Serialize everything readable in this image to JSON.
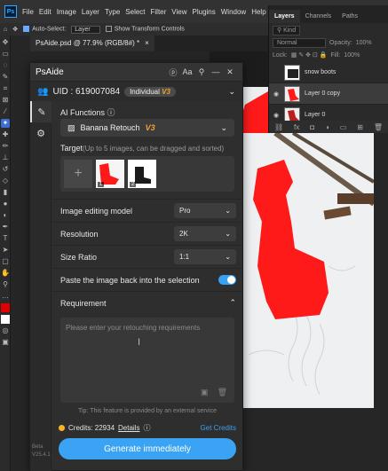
{
  "app": {
    "menu": [
      "File",
      "Edit",
      "Image",
      "Layer",
      "Type",
      "Select",
      "Filter",
      "View",
      "Plugins",
      "Window",
      "Help"
    ],
    "logo": "Ps",
    "options": {
      "auto_select_label": "Auto-Select:",
      "auto_select_value": "Layer",
      "show_transform_label": "Show Transform Controls"
    },
    "document_tab": "PsAide.psd @ 77.9% (RGB/8#) *",
    "document_close": "×"
  },
  "layers_panel": {
    "tabs": [
      "Layers",
      "Channels",
      "Paths"
    ],
    "kind_label": "Kind",
    "blend_mode": "Normal",
    "opacity_label": "Opacity:",
    "opacity_value": "100%",
    "lock_label": "Lock:",
    "fill_label": "Fill:",
    "fill_value": "100%",
    "layers": [
      {
        "name": "snow boots",
        "visible": false
      },
      {
        "name": "Layer 0 copy",
        "visible": true
      },
      {
        "name": "Layer 0",
        "visible": true
      }
    ],
    "footer_icons": [
      "link-icon",
      "fx-icon",
      "mask-icon",
      "adjustment-icon",
      "folder-icon",
      "new-layer-icon",
      "trash-icon"
    ]
  },
  "plugin": {
    "title": "PsAide",
    "title_icons": [
      "logo-icon",
      "font-size-icon",
      "pin-icon",
      "minimize-icon",
      "close-icon"
    ],
    "uid_label": "UID : 619007084",
    "plan_badge": "Individual",
    "plan_badge_version": "V3",
    "ai_functions_label": "AI Functions",
    "function_value": "Banana Retouch",
    "function_version": "V3",
    "target_label": "Target",
    "target_hint": "(Up to 5 images, can be dragged and sorted)",
    "target_images": [
      "1",
      "2"
    ],
    "model_label": "Image editing model",
    "model_value": "Pro",
    "resolution_label": "Resolution",
    "resolution_value": "2K",
    "size_ratio_label": "Size Ratio",
    "size_ratio_value": "1:1",
    "paste_back_label": "Paste the image back into the selection",
    "paste_back_on": true,
    "requirement_label": "Requirement",
    "requirement_placeholder": "Please enter your retouching requirements",
    "tip": "Tip: This feature is provided by an external service",
    "credits_label": "Credits: 22934",
    "details_link": "Details",
    "get_credits": "Get Credits",
    "generate_button": "Generate immediately",
    "side_version": "Beta V25.4.1"
  },
  "colors": {
    "accent": "#3aa3f3",
    "version_orange": "#f0a030",
    "selection_red": "#ff1a1a"
  }
}
